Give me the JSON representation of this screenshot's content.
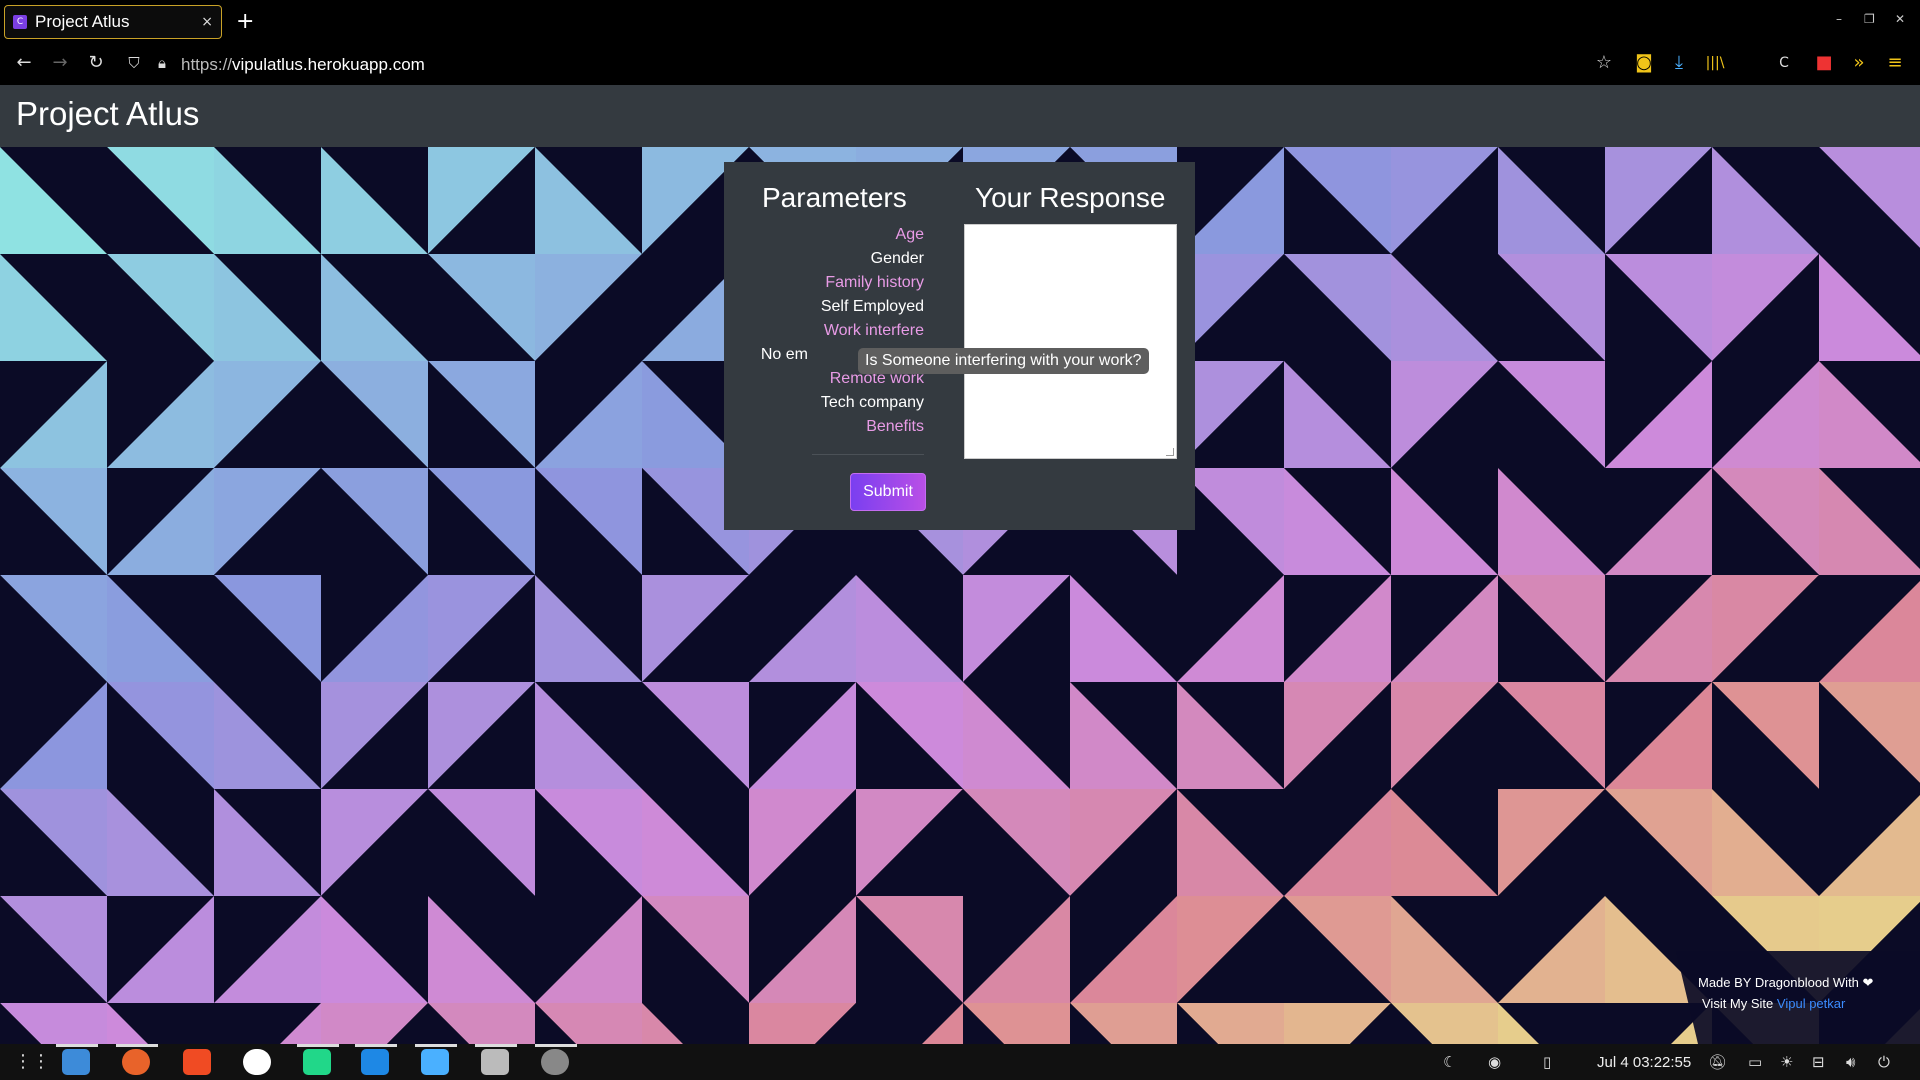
{
  "browser": {
    "tab_title": "Project Atlus",
    "tab_close": "×",
    "new_tab": "+",
    "url_prefix": "https://",
    "url_domain": "vipulatlus.herokuapp.com",
    "icons": [
      "back-icon",
      "forward-icon",
      "reload-icon",
      "shield-icon",
      "lock-icon",
      "bookmark-star-icon",
      "pocket-icon",
      "download-icon",
      "library-icon",
      "sync-icon",
      "extension-icon",
      "overflow-icon",
      "menu-icon"
    ]
  },
  "header": {
    "title": "Project Atlus"
  },
  "form": {
    "parameters_title": "Parameters",
    "response_title": "Your Response",
    "parameters": [
      {
        "label": "Age",
        "color": "#e89be6"
      },
      {
        "label": "Gender",
        "color": "#ffffff"
      },
      {
        "label": "Family history",
        "color": "#e89be6"
      },
      {
        "label": "Self Employed",
        "color": "#ffffff"
      },
      {
        "label": "Work interfere",
        "color": "#e89be6"
      },
      {
        "label": "No em",
        "color": "#ffffff"
      },
      {
        "label": "Remote work",
        "color": "#e89be6"
      },
      {
        "label": "Tech company",
        "color": "#ffffff"
      },
      {
        "label": "Benefits",
        "color": "#e89be6"
      }
    ],
    "response_value": "",
    "submit_label": "Submit"
  },
  "tooltip": {
    "text": "Is Someone interfering with your work?"
  },
  "footer": {
    "line1": "Made BY Dragonblood With ❤",
    "line2_prefix": "Visit My Site",
    "link_text": "Vipul petkar"
  },
  "taskbar": {
    "clock": "Jul 4  03:22:55"
  },
  "colors": {
    "header_bg": "#343a40",
    "pattern_dark": "#0b0b26",
    "accent_pink": "#e89be6",
    "submit_gradient": [
      "#7a3ff0",
      "#b94fe6"
    ],
    "link": "#3b8cff"
  }
}
